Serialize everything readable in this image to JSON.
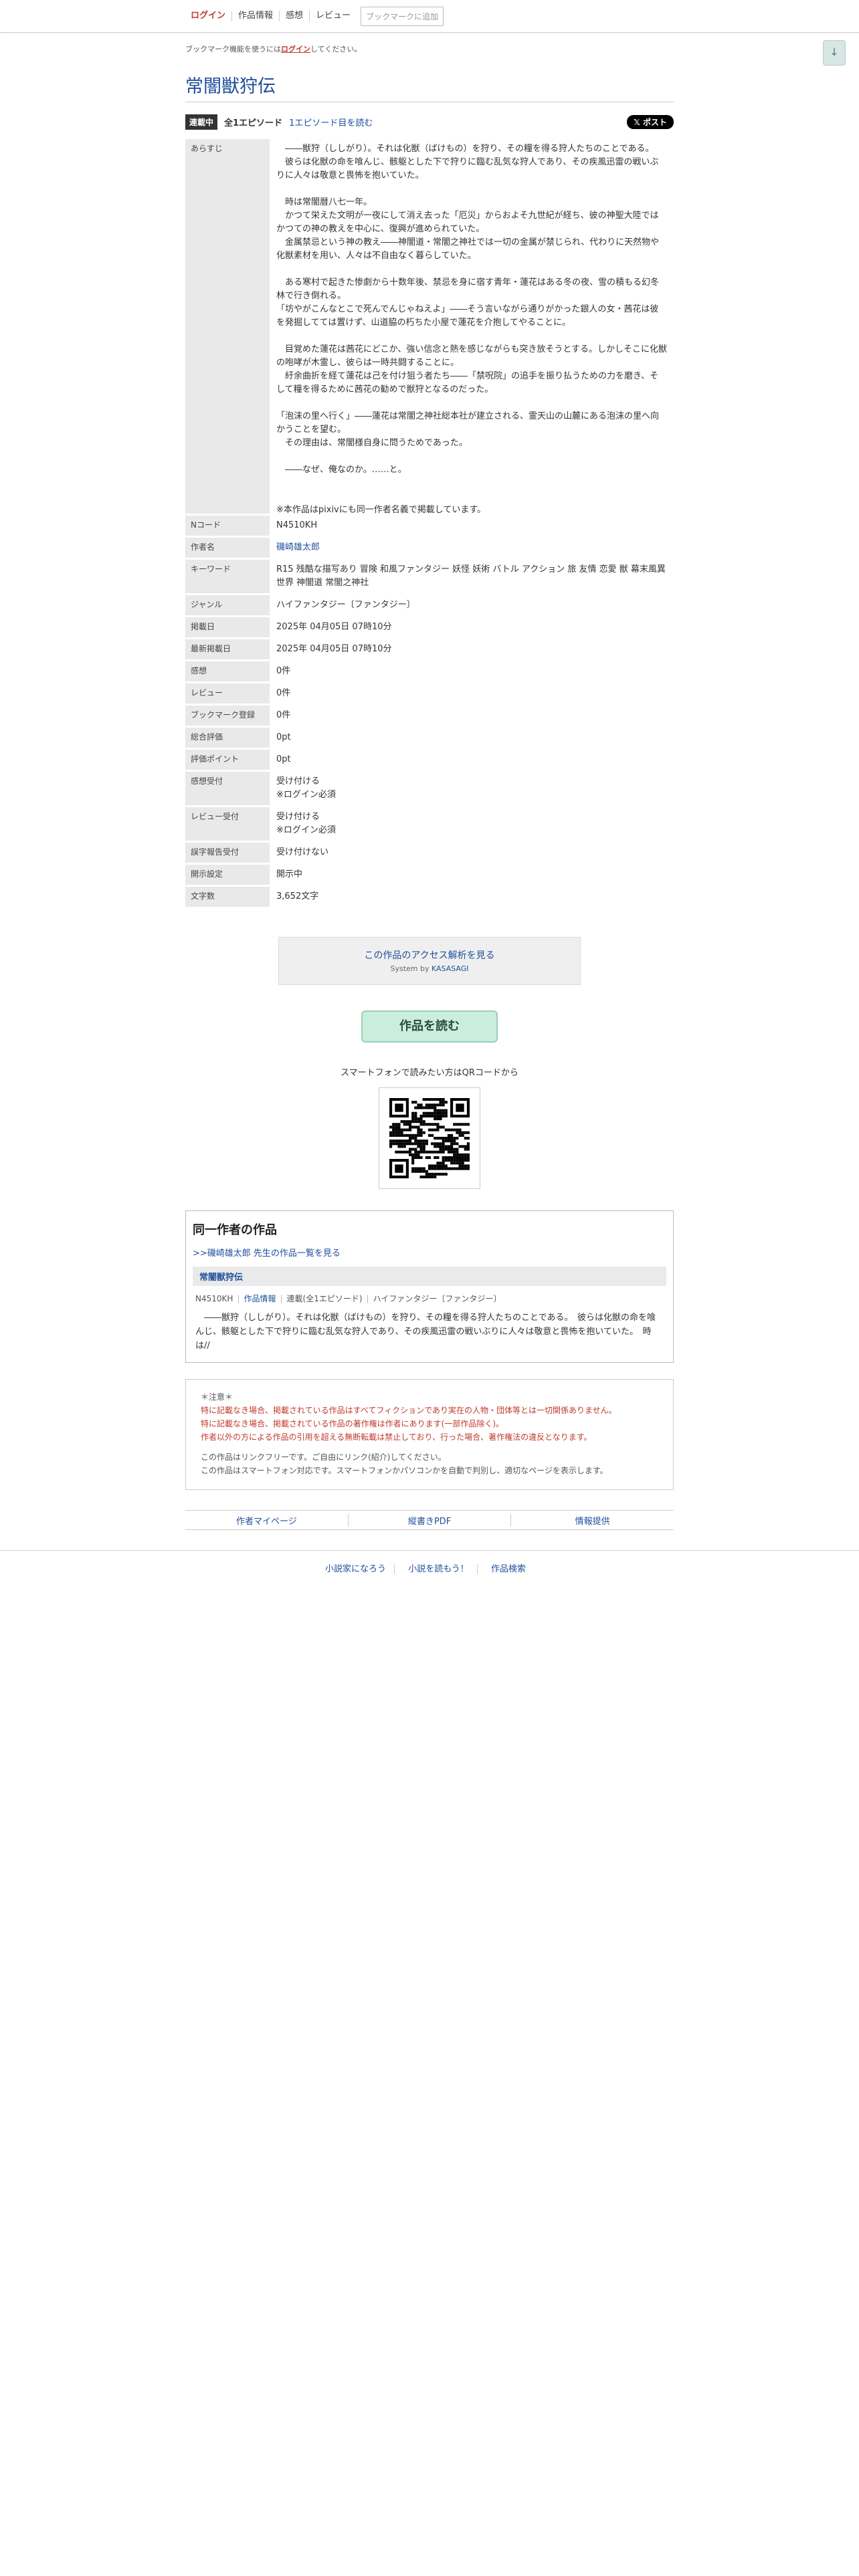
{
  "nav": {
    "login": "ログイン",
    "info": "作品情報",
    "impressions": "感想",
    "review": "レビュー",
    "bookmark_add": "ブックマークに追加",
    "pagetop_icon": "arrow-down-icon"
  },
  "bookmark_note": {
    "prefix": "ブックマーク機能を使うには",
    "link": "ログイン",
    "suffix": "してください。"
  },
  "title": "常闇獣狩伝",
  "status": {
    "badge": "連載中",
    "episodes": "全1エピソード",
    "read_first": "1エピソード目を読む",
    "x_post": "𝕏 ポスト"
  },
  "info": {
    "labels": {
      "synopsis": "あらすじ",
      "ncode": "Nコード",
      "author": "作者名",
      "keywords": "キーワード",
      "genre": "ジャンル",
      "published": "掲載日",
      "updated": "最新掲載日",
      "impressions": "感想",
      "reviews": "レビュー",
      "bookmarks": "ブックマーク登録",
      "total_rating": "総合評価",
      "rating_points": "評価ポイント",
      "impression_accept": "感想受付",
      "review_accept": "レビュー受付",
      "typo_report": "誤字報告受付",
      "disclosure": "開示設定",
      "char_count": "文字数"
    },
    "synopsis": [
      "　――獣狩（ししがり）。それは化獣（ばけもの）を狩り、その糧を得る狩人たちのことである。",
      "　彼らは化獣の命を喰んじ、骸躯とした下で狩りに臨む乱気な狩人であり、その疾風迅雷の戦いぶりに人々は敬意と畏怖を抱いていた。",
      "",
      "　時は常闇暦八七一年。",
      "　かつて栄えた文明が一夜にして消え去った「厄災」からおよそ九世紀が経ち、彼の神聖大陸ではかつての神の教えを中心に、復興が進められていた。",
      "　金属禁忌という神の教え――神闇道・常闇之神社では一切の金属が禁じられ、代わりに天然物や化獣素材を用い、人々は不自由なく暮らしていた。",
      "",
      "　ある寒村で起きた惨劇から十数年後、禁忌を身に宿す青年・蓮花はある冬の夜、雪の積もる幻冬林で行き倒れる。",
      "「坊やがこんなとこで死んでんじゃねえよ」――そう言いながら通りがかった銀人の女・茜花は彼を発掘してては置けず、山道脇の朽ちた小屋で蓮花を介抱してやることに。",
      "",
      "　目覚めた蓮花は茜花にどこか、強い信念と熱を感じながらも突き放そうとする。しかしそこに化獣の咆哮が木霊し、彼らは一時共闘することに。",
      "　紆余曲折を経て蓮花は己を付け狙う者たち――「禁呪院」の追手を振り払うための力を磨き、そして糧を得るために茜花の勧めで獣狩となるのだった。",
      "",
      "「泡沫の里へ行く」――蓮花は常闇之神社総本社が建立される、霊天山の山麓にある泡沫の里へ向かうことを望む。",
      "　その理由は、常闇様自身に問うためであった。",
      "",
      "　――なぜ、俺なのか。……と。",
      "",
      "",
      "※本作品はpixivにも同一作者名義で掲載しています。"
    ],
    "ncode": "N4510KH",
    "author": "磯崎雄太郎",
    "keywords": "R15 残酷な描写あり 冒険 和風ファンタジー 妖怪 妖術 バトル アクション 旅 友情 恋愛 獣 幕末風異世界 神闇道 常闇之神社",
    "genre": "ハイファンタジー〔ファンタジー〕",
    "published": "2025年 04月05日 07時10分",
    "updated": "2025年 04月05日 07時10分",
    "impressions": "0件",
    "reviews": "0件",
    "bookmarks": "0件",
    "total_rating": "0pt",
    "rating_points": "0pt",
    "impression_accept_1": "受け付ける",
    "impression_accept_2": "※ログイン必須",
    "review_accept_1": "受け付ける",
    "review_accept_2": "※ログイン必須",
    "typo_report": "受け付けない",
    "disclosure": "開示中",
    "char_count": "3,652文字"
  },
  "access": {
    "link": "この作品のアクセス解析を見る",
    "system_prefix": "System by ",
    "system_name": "KASASAGI"
  },
  "read_button": "作品を読む",
  "qr_text": "スマートフォンで読みたい方はQRコードから",
  "same_author": {
    "heading": "同一作者の作品",
    "more": ">>磯崎雄太郎 先生の作品一覧を見る",
    "work_title": "常闇獣狩伝",
    "ncode": "N4510KH",
    "info_link": "作品情報",
    "status": "連載(全1エピソード)",
    "genre": "ハイファンタジー〔ファンタジー〕",
    "excerpt": "　――獣狩（ししがり）。それは化獣（ばけもの）を狩り、その糧を得る狩人たちのことである。　彼らは化獣の命を喰んじ、骸躯とした下で狩りに臨む乱気な狩人であり、その疾風迅雷の戦いぶりに人々は敬意と畏怖を抱いていた。　時は//"
  },
  "caution": {
    "head": "＊注意＊",
    "red1": "特に記載なき場合、掲載されている作品はすべてフィクションであり実在の人物・団体等とは一切関係ありません。",
    "red2": "特に記載なき場合、掲載されている作品の著作権は作者にあります(一部作品除く)。",
    "red3": "作者以外の方による作品の引用を超える無断転載は禁止しており、行った場合、著作権法の違反となります。",
    "gray1": "この作品はリンクフリーです。ご自由にリンク(紹介)してください。",
    "gray2": "この作品はスマートフォン対応です。スマートフォンかパソコンかを自動で判別し、適切なページを表示します。"
  },
  "bottom_links": {
    "mypage": "作者マイページ",
    "pdf": "縦書きPDF",
    "report": "情報提供"
  },
  "footer": {
    "l1": "小説家になろう",
    "l2": "小説を読もう！",
    "l3": "作品検索"
  }
}
